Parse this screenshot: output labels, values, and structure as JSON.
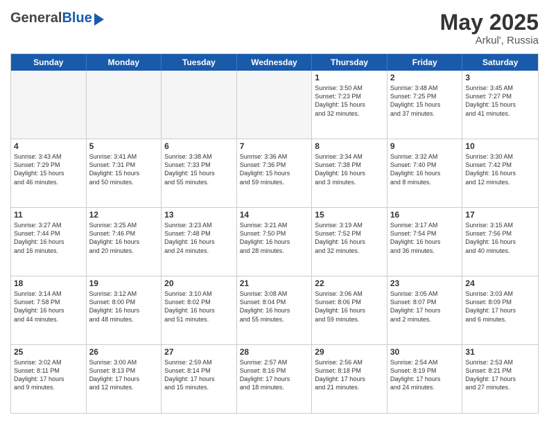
{
  "header": {
    "logo_general": "General",
    "logo_blue": "Blue",
    "month": "May 2025",
    "location": "Arkul', Russia"
  },
  "days_of_week": [
    "Sunday",
    "Monday",
    "Tuesday",
    "Wednesday",
    "Thursday",
    "Friday",
    "Saturday"
  ],
  "rows": [
    [
      {
        "day": "",
        "empty": true
      },
      {
        "day": "",
        "empty": true
      },
      {
        "day": "",
        "empty": true
      },
      {
        "day": "",
        "empty": true
      },
      {
        "day": "1",
        "lines": [
          "Sunrise: 3:50 AM",
          "Sunset: 7:23 PM",
          "Daylight: 15 hours",
          "and 32 minutes."
        ]
      },
      {
        "day": "2",
        "lines": [
          "Sunrise: 3:48 AM",
          "Sunset: 7:25 PM",
          "Daylight: 15 hours",
          "and 37 minutes."
        ]
      },
      {
        "day": "3",
        "lines": [
          "Sunrise: 3:45 AM",
          "Sunset: 7:27 PM",
          "Daylight: 15 hours",
          "and 41 minutes."
        ]
      }
    ],
    [
      {
        "day": "4",
        "lines": [
          "Sunrise: 3:43 AM",
          "Sunset: 7:29 PM",
          "Daylight: 15 hours",
          "and 46 minutes."
        ]
      },
      {
        "day": "5",
        "lines": [
          "Sunrise: 3:41 AM",
          "Sunset: 7:31 PM",
          "Daylight: 15 hours",
          "and 50 minutes."
        ]
      },
      {
        "day": "6",
        "lines": [
          "Sunrise: 3:38 AM",
          "Sunset: 7:33 PM",
          "Daylight: 15 hours",
          "and 55 minutes."
        ]
      },
      {
        "day": "7",
        "lines": [
          "Sunrise: 3:36 AM",
          "Sunset: 7:36 PM",
          "Daylight: 15 hours",
          "and 59 minutes."
        ]
      },
      {
        "day": "8",
        "lines": [
          "Sunrise: 3:34 AM",
          "Sunset: 7:38 PM",
          "Daylight: 16 hours",
          "and 3 minutes."
        ]
      },
      {
        "day": "9",
        "lines": [
          "Sunrise: 3:32 AM",
          "Sunset: 7:40 PM",
          "Daylight: 16 hours",
          "and 8 minutes."
        ]
      },
      {
        "day": "10",
        "lines": [
          "Sunrise: 3:30 AM",
          "Sunset: 7:42 PM",
          "Daylight: 16 hours",
          "and 12 minutes."
        ]
      }
    ],
    [
      {
        "day": "11",
        "lines": [
          "Sunrise: 3:27 AM",
          "Sunset: 7:44 PM",
          "Daylight: 16 hours",
          "and 16 minutes."
        ]
      },
      {
        "day": "12",
        "lines": [
          "Sunrise: 3:25 AM",
          "Sunset: 7:46 PM",
          "Daylight: 16 hours",
          "and 20 minutes."
        ]
      },
      {
        "day": "13",
        "lines": [
          "Sunrise: 3:23 AM",
          "Sunset: 7:48 PM",
          "Daylight: 16 hours",
          "and 24 minutes."
        ]
      },
      {
        "day": "14",
        "lines": [
          "Sunrise: 3:21 AM",
          "Sunset: 7:50 PM",
          "Daylight: 16 hours",
          "and 28 minutes."
        ]
      },
      {
        "day": "15",
        "lines": [
          "Sunrise: 3:19 AM",
          "Sunset: 7:52 PM",
          "Daylight: 16 hours",
          "and 32 minutes."
        ]
      },
      {
        "day": "16",
        "lines": [
          "Sunrise: 3:17 AM",
          "Sunset: 7:54 PM",
          "Daylight: 16 hours",
          "and 36 minutes."
        ]
      },
      {
        "day": "17",
        "lines": [
          "Sunrise: 3:15 AM",
          "Sunset: 7:56 PM",
          "Daylight: 16 hours",
          "and 40 minutes."
        ]
      }
    ],
    [
      {
        "day": "18",
        "lines": [
          "Sunrise: 3:14 AM",
          "Sunset: 7:58 PM",
          "Daylight: 16 hours",
          "and 44 minutes."
        ]
      },
      {
        "day": "19",
        "lines": [
          "Sunrise: 3:12 AM",
          "Sunset: 8:00 PM",
          "Daylight: 16 hours",
          "and 48 minutes."
        ]
      },
      {
        "day": "20",
        "lines": [
          "Sunrise: 3:10 AM",
          "Sunset: 8:02 PM",
          "Daylight: 16 hours",
          "and 51 minutes."
        ]
      },
      {
        "day": "21",
        "lines": [
          "Sunrise: 3:08 AM",
          "Sunset: 8:04 PM",
          "Daylight: 16 hours",
          "and 55 minutes."
        ]
      },
      {
        "day": "22",
        "lines": [
          "Sunrise: 3:06 AM",
          "Sunset: 8:06 PM",
          "Daylight: 16 hours",
          "and 59 minutes."
        ]
      },
      {
        "day": "23",
        "lines": [
          "Sunrise: 3:05 AM",
          "Sunset: 8:07 PM",
          "Daylight: 17 hours",
          "and 2 minutes."
        ]
      },
      {
        "day": "24",
        "lines": [
          "Sunrise: 3:03 AM",
          "Sunset: 8:09 PM",
          "Daylight: 17 hours",
          "and 6 minutes."
        ]
      }
    ],
    [
      {
        "day": "25",
        "lines": [
          "Sunrise: 3:02 AM",
          "Sunset: 8:11 PM",
          "Daylight: 17 hours",
          "and 9 minutes."
        ]
      },
      {
        "day": "26",
        "lines": [
          "Sunrise: 3:00 AM",
          "Sunset: 8:13 PM",
          "Daylight: 17 hours",
          "and 12 minutes."
        ]
      },
      {
        "day": "27",
        "lines": [
          "Sunrise: 2:59 AM",
          "Sunset: 8:14 PM",
          "Daylight: 17 hours",
          "and 15 minutes."
        ]
      },
      {
        "day": "28",
        "lines": [
          "Sunrise: 2:57 AM",
          "Sunset: 8:16 PM",
          "Daylight: 17 hours",
          "and 18 minutes."
        ]
      },
      {
        "day": "29",
        "lines": [
          "Sunrise: 2:56 AM",
          "Sunset: 8:18 PM",
          "Daylight: 17 hours",
          "and 21 minutes."
        ]
      },
      {
        "day": "30",
        "lines": [
          "Sunrise: 2:54 AM",
          "Sunset: 8:19 PM",
          "Daylight: 17 hours",
          "and 24 minutes."
        ]
      },
      {
        "day": "31",
        "lines": [
          "Sunrise: 2:53 AM",
          "Sunset: 8:21 PM",
          "Daylight: 17 hours",
          "and 27 minutes."
        ]
      }
    ]
  ]
}
